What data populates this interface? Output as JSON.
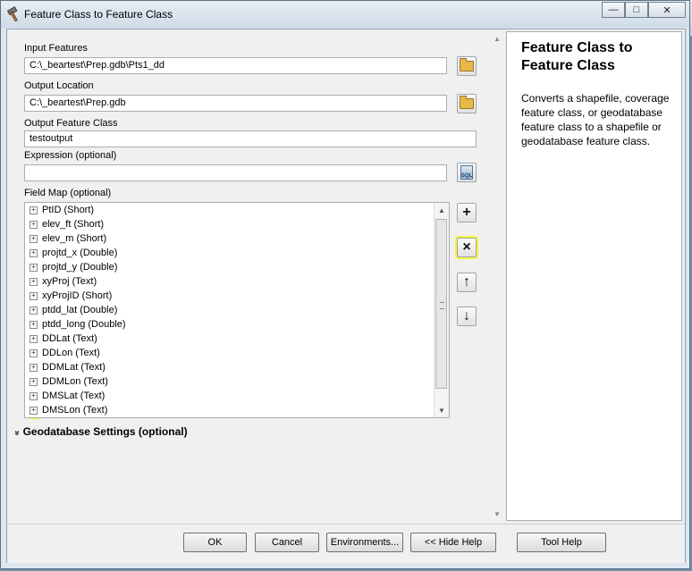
{
  "window": {
    "title": "Feature Class to Feature Class",
    "controls": [
      "minimize",
      "maximize",
      "close"
    ]
  },
  "form": {
    "input_features": {
      "label": "Input Features",
      "value": "C:\\_beartest\\Prep.gdb\\Pts1_dd"
    },
    "output_location": {
      "label": "Output Location",
      "value": "C:\\_beartest\\Prep.gdb"
    },
    "output_feature_class": {
      "label": "Output Feature Class",
      "value": "testoutput"
    },
    "expression": {
      "label": "Expression (optional)",
      "value": "",
      "sql_icon_text": "SQL"
    },
    "field_map": {
      "label": "Field Map (optional)",
      "items": [
        "PtID (Short)",
        "elev_ft (Short)",
        "elev_m (Short)",
        "projtd_x (Double)",
        "projtd_y (Double)",
        "xyProj (Text)",
        "xyProjID (Short)",
        "ptdd_lat (Double)",
        "ptdd_long (Double)",
        "DDLat (Text)",
        "DDLon (Text)",
        "DDMLat (Text)",
        "DDMLon (Text)",
        "DMSLat (Text)",
        "DMSLon (Text)"
      ],
      "expander_symbol": "+",
      "buttons": {
        "add": "+",
        "remove": "×",
        "up": "↑",
        "down": "↓"
      }
    },
    "geodatabase_settings": {
      "label": "Geodatabase Settings (optional)",
      "chevron": "»"
    }
  },
  "help_panel": {
    "title": "Feature Class to Feature Class",
    "body": "Converts a shapefile, coverage feature class, or geodatabase feature class to a shapefile or geodatabase feature class."
  },
  "buttons": {
    "ok": "OK",
    "cancel": "Cancel",
    "environments": "Environments...",
    "hide_help": "<< Hide Help",
    "tool_help": "Tool Help"
  },
  "colors": {
    "highlight": "#f5f51e",
    "window_frame": "#dde6ef",
    "client_bg": "#f0f0f0"
  }
}
